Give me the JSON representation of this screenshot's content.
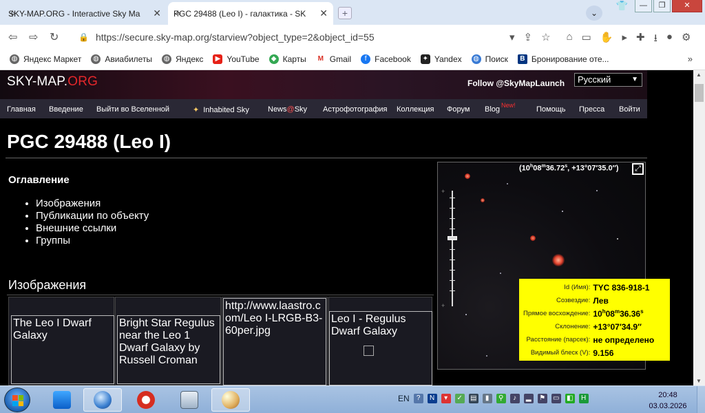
{
  "browser": {
    "tabs": [
      {
        "title": "SKY-MAP.ORG - Interactive Sky Ma",
        "active": false
      },
      {
        "title": "PGC 29488 (Leo I) - галактика - SK",
        "active": true
      }
    ],
    "url": "https://secure.sky-map.org/starview?object_type=2&object_id=55",
    "bookmarks": [
      {
        "label": "Яндекс Маркет",
        "icon": "globe-icon"
      },
      {
        "label": "Авиабилеты",
        "icon": "globe-icon"
      },
      {
        "label": "Яндекс",
        "icon": "globe-icon"
      },
      {
        "label": "YouTube",
        "icon": "youtube-icon"
      },
      {
        "label": "Карты",
        "icon": "maps-icon"
      },
      {
        "label": "Gmail",
        "icon": "gmail-icon"
      },
      {
        "label": "Facebook",
        "icon": "facebook-icon"
      },
      {
        "label": "Yandex",
        "icon": "star-icon"
      },
      {
        "label": "Поиск",
        "icon": "globe-icon"
      },
      {
        "label": "Бронирование оте...",
        "icon": "booking-icon"
      }
    ]
  },
  "site": {
    "logo_main": "SKY-MAP.",
    "logo_org": "ORG",
    "follow": "Follow @SkyMapLaunch",
    "language": "Русский",
    "menu": {
      "home": "Главная",
      "intro": "Введение",
      "exit": "Выйти во Вселенной",
      "inhabited": "Inhabited Sky",
      "news_a": "News",
      "news_at": "@",
      "news_b": "Sky",
      "astrophoto": "Астрофотография",
      "collection": "Коллекция",
      "forum": "Форум",
      "blog": "Blog",
      "blog_new": "New!",
      "help": "Помощь",
      "press": "Пресса",
      "login": "Войти"
    }
  },
  "object": {
    "title": "PGC 29488 (Leo I)",
    "toc_heading": "Оглавление",
    "toc": [
      "Изображения",
      "Публикации по объекту",
      "Внешние ссылки",
      "Группы"
    ],
    "images_heading": "Изображения",
    "images": [
      "The Leo I Dwarf Galaxy",
      "Bright Star Regulus near the Leo 1 Dwarf Galaxy by Russell Croman",
      "http://www.laastro.com/Leo I-LRGB-B3-60per.jpg",
      "Leo I - Regulus Dwarf Galaxy"
    ]
  },
  "viewer": {
    "coords_ra_h": "10",
    "coords_ra_m": "08",
    "coords_ra_s": "36.72",
    "coords_dec": "+13°07′35.0″",
    "info": {
      "id_label": "Id (Имя):",
      "id_value": "TYC 836-918-1",
      "const_label": "Созвездие:",
      "const_value": "Лев",
      "ra_label": "Прямое восхождение:",
      "ra_h": "10",
      "ra_m": "08",
      "ra_s": "36.36",
      "dec_label": "Склонение:",
      "dec_value": "+13°07′34.9″",
      "dist_label": "Расстояние (парсек):",
      "dist_value": "не определено",
      "mag_label": "Видимый блеск (V):",
      "mag_value": "9.156"
    }
  },
  "taskbar": {
    "lang": "EN",
    "time": "20:48",
    "date": "03.03.2026"
  }
}
